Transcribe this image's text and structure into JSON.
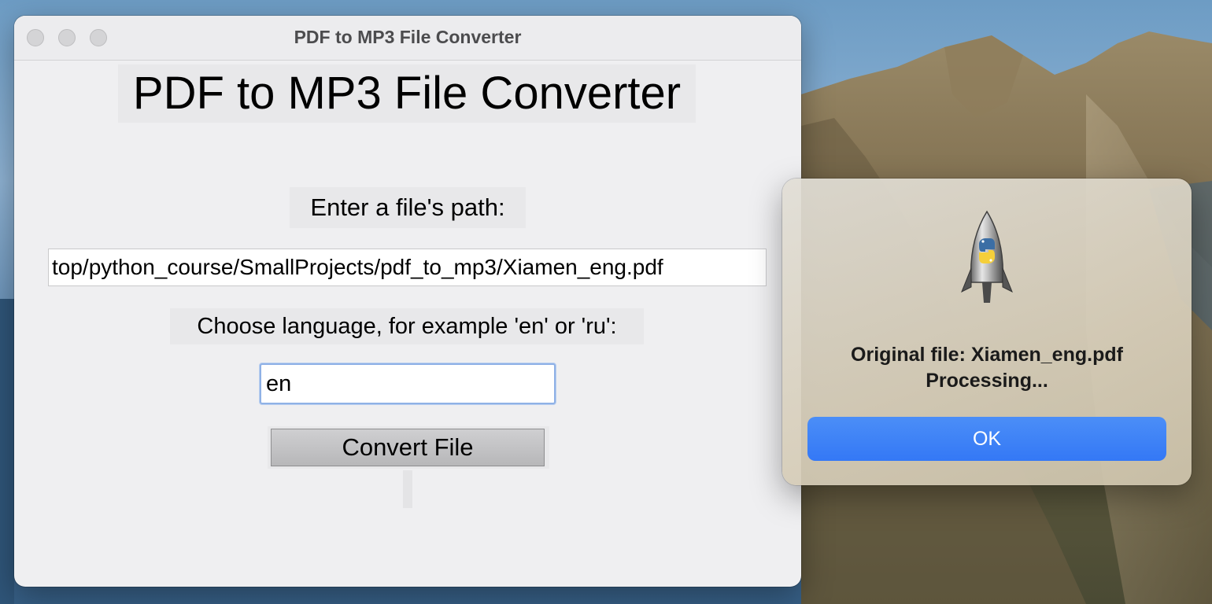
{
  "window": {
    "title": "PDF to MP3 File Converter"
  },
  "main": {
    "heading": "PDF to MP3 File Converter",
    "path_label": "Enter a file's path:",
    "path_value": "top/python_course/SmallProjects/pdf_to_mp3/Xiamen_eng.pdf",
    "language_label": "Choose language, for example 'en' or 'ru':",
    "language_value": "en",
    "convert_label": "Convert File"
  },
  "alert": {
    "icon": "python-launcher-rocket-icon",
    "line1": "Original file: Xiamen_eng.pdf",
    "line2": "Processing...",
    "ok_label": "OK"
  },
  "colors": {
    "accent": "#3478f6",
    "window_bg": "#efeff1"
  }
}
